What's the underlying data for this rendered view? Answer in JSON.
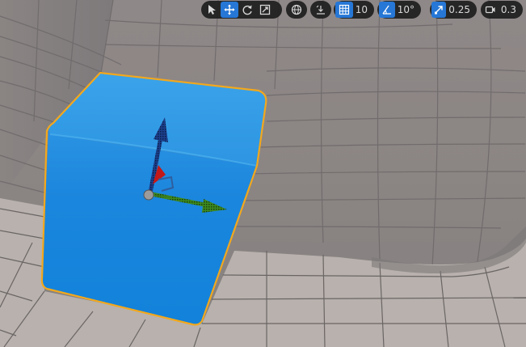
{
  "toolbar": {
    "transform_modes": [
      {
        "name": "select-icon",
        "active": false
      },
      {
        "name": "translate-icon",
        "active": true
      },
      {
        "name": "rotate-icon",
        "active": false
      },
      {
        "name": "scale-icon",
        "active": false
      }
    ],
    "coordinate_space_icon": "globe-icon",
    "surface_snapping_icon": "surface-snap-icon",
    "grid_snap": {
      "icon": "grid-snap-icon",
      "enabled": true,
      "value": "10"
    },
    "rotation_snap": {
      "icon": "angle-snap-icon",
      "enabled": true,
      "value": "10°"
    },
    "scale_snap": {
      "icon": "scale-snap-icon",
      "enabled": true,
      "value": "0.25"
    },
    "camera_speed": {
      "icon": "camera-icon",
      "value": "0.3"
    }
  },
  "viewport": {
    "selected_object": "cube",
    "selection_outline_color": "#f2a81d",
    "cube_color": "#1d8ee4",
    "gizmo_axis_colors": {
      "x": "#d31a1a",
      "y": "#3da41f",
      "z": "#1f4fb3"
    },
    "floor_color": "#b9b2ae",
    "wall_color": "#8e8885"
  }
}
